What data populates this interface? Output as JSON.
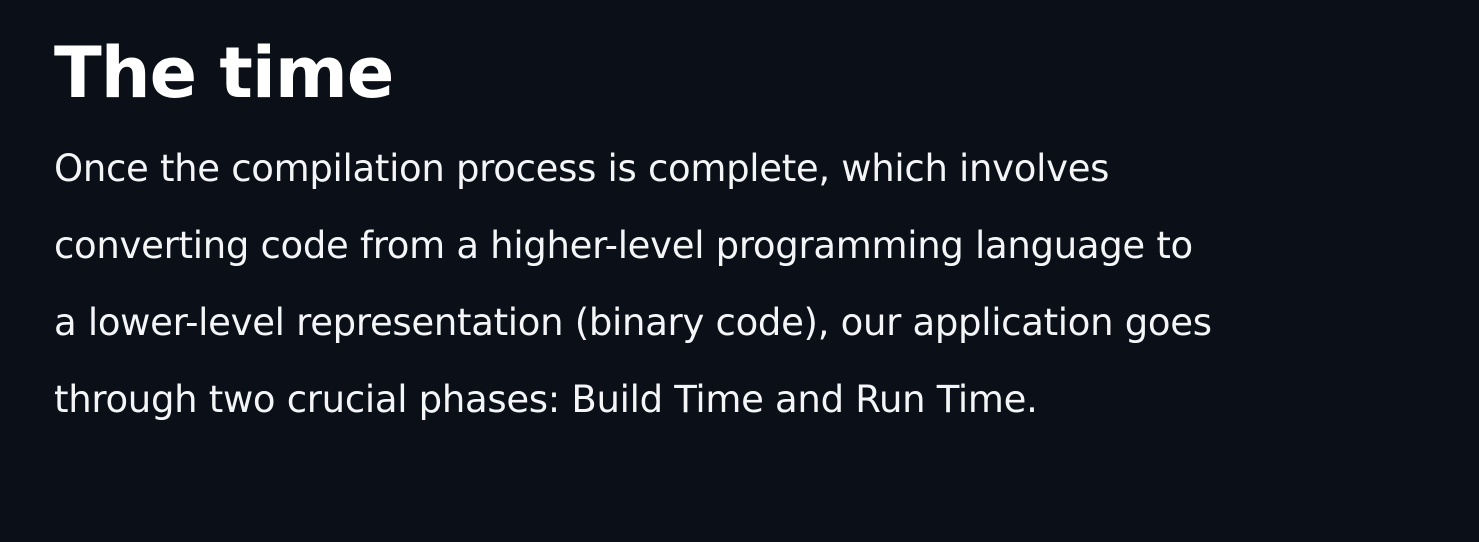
{
  "title": "The time",
  "paragraph": {
    "lines": [
      "Once the compilation process is complete, which involves",
      "converting code from a higher-level programming language to",
      "a lower-level representation (binary code), our application goes",
      "through two crucial phases: Build Time and Run Time."
    ]
  },
  "colors": {
    "background": "#0b0f18",
    "text": "#ffffff"
  }
}
